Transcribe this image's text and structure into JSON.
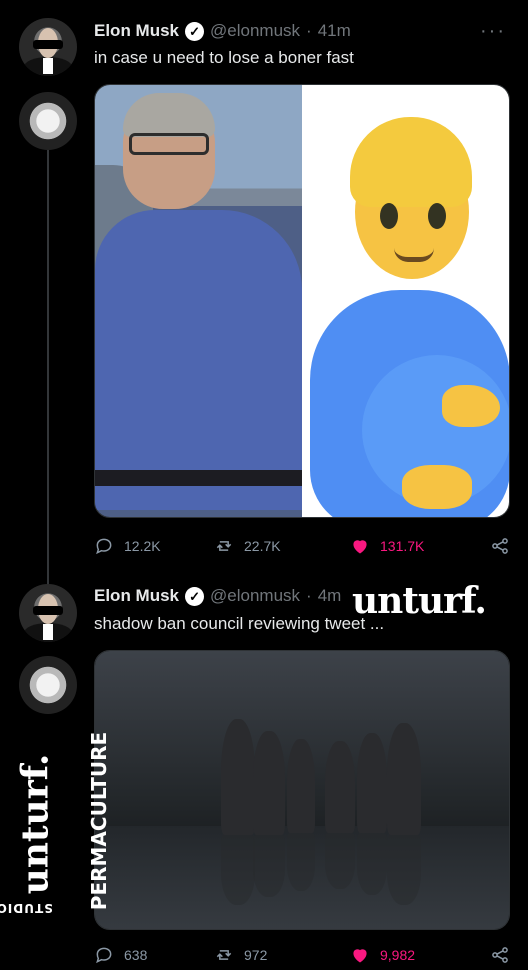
{
  "tweets": [
    {
      "name": "Elon Musk",
      "verified": "✓",
      "handle": "@elonmusk",
      "dot": "·",
      "time": "41m",
      "text": "in case u need to lose a boner fast",
      "replies": "12.2K",
      "retweets": "22.7K",
      "likes": "131.7K"
    },
    {
      "name": "Elon Musk",
      "verified": "✓",
      "handle": "@elonmusk",
      "dot": "·",
      "time": "4m",
      "text": "shadow ban council reviewing tweet ...",
      "replies": "638",
      "retweets": "972",
      "likes": "9,982"
    }
  ],
  "more_label": "···",
  "watermark": {
    "top": "unturf.",
    "side_main": "unturf.",
    "side_sub": "PERMACULTURE",
    "side_studios": "STUDIOS"
  },
  "colors": {
    "background": "#000000",
    "muted": "#71767b",
    "like": "#f91880"
  }
}
